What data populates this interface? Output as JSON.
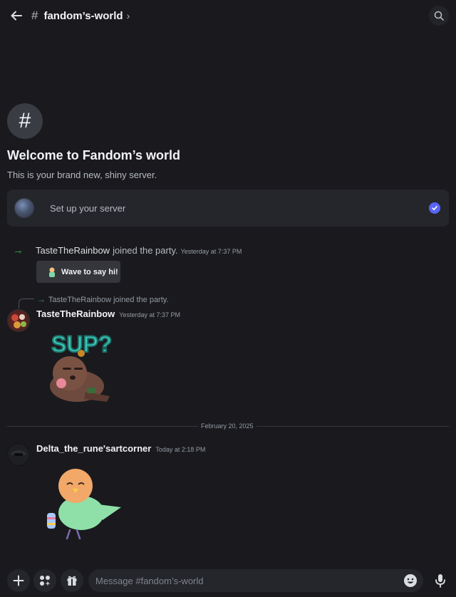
{
  "header": {
    "back_icon": "arrow-left-icon",
    "hash_symbol": "#",
    "channel_name": "fandom’s-world",
    "chevron": "›",
    "search_icon": "search-icon"
  },
  "welcome": {
    "icon_symbol": "#",
    "title": "Welcome to Fandom’s world",
    "subtitle": "This is your brand new, shiny server."
  },
  "setup_card": {
    "label": "Set up your server",
    "checked": true,
    "check_color": "#5865f2"
  },
  "messages": [
    {
      "type": "system",
      "arrow": "→",
      "username": "TasteTheRainbow",
      "text": "joined the party.",
      "time": "Yesterday at 7:37 PM",
      "wave_button": "Wave to say hi!"
    },
    {
      "type": "sticker",
      "reply_arrow": "→",
      "reply_username": "TasteTheRainbow",
      "reply_text": "joined the party.",
      "author": "TasteTheRainbow",
      "time": "Yesterday at 7:37 PM",
      "sticker": "sup-bear-sticker",
      "sticker_text": "SUP?"
    }
  ],
  "date_divider": "February 20, 2025",
  "messages_after": [
    {
      "author": "Delta_the_rune'sartcorner",
      "time": "Today at 2:18 PM",
      "sticker": "bird-sticker"
    }
  ],
  "composer": {
    "add_icon": "plus-icon",
    "apps_icon": "apps-icon",
    "gift_icon": "gift-icon",
    "placeholder": "Message #fandom’s-world",
    "emoji_icon": "emoji-icon",
    "mic_icon": "microphone-icon"
  },
  "colors": {
    "background": "#1a1a1e",
    "accent": "#5865f2",
    "join_green": "#3ba55c"
  }
}
